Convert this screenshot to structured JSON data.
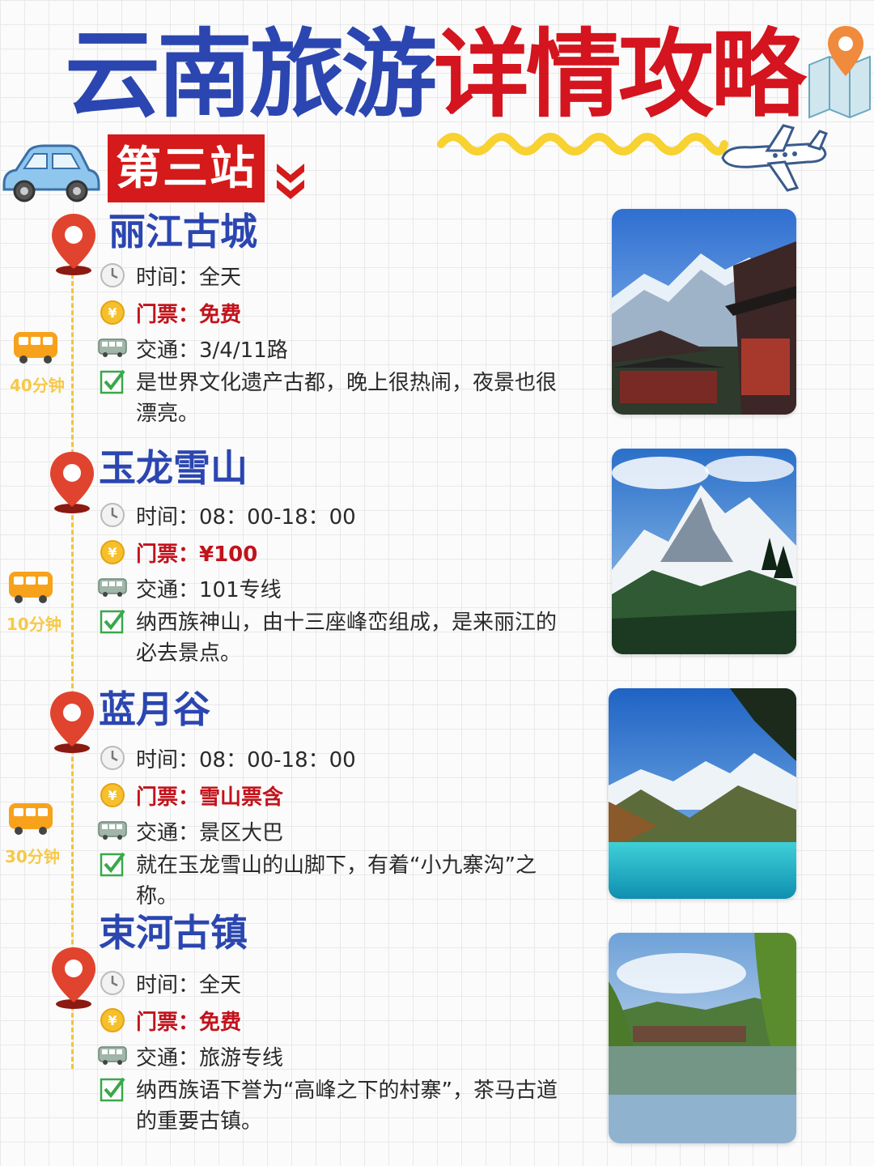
{
  "title": {
    "part1": "云南旅游",
    "part2": "详情攻略"
  },
  "station": "第三站",
  "transfers": [
    "40分钟",
    "10分钟",
    "30分钟"
  ],
  "spots": [
    {
      "name": "丽江古城",
      "time": "时间：全天",
      "ticket": "门票：免费",
      "transport": "交通：3/4/11路",
      "desc": "是世界文化遗产古都，晚上很热闹，夜景也很漂亮。"
    },
    {
      "name": "玉龙雪山",
      "time": "时间：08：00-18：00",
      "ticket": "门票：¥100",
      "transport": "交通：101专线",
      "desc": "纳西族神山，由十三座峰峦组成，是来丽江的必去景点。"
    },
    {
      "name": "蓝月谷",
      "time": "时间：08：00-18：00",
      "ticket": "门票：雪山票含",
      "transport": "交通：景区大巴",
      "desc": "就在玉龙雪山的山脚下，有着“小九寨沟”之称。"
    },
    {
      "name": "束河古镇",
      "time": "时间：全天",
      "ticket": "门票：免费",
      "transport": "交通：旅游专线",
      "desc": "纳西族语下誉为“高峰之下的村寨”，茶马古道的重要古镇。"
    }
  ],
  "icons": {
    "clock": "clock-icon",
    "coin": "coin-icon",
    "bus": "bus-icon",
    "check": "checkbox-icon",
    "pin": "map-pin-icon"
  },
  "colors": {
    "blue": "#2b46b0",
    "red": "#d4141e",
    "yellow": "#f4c23c"
  }
}
